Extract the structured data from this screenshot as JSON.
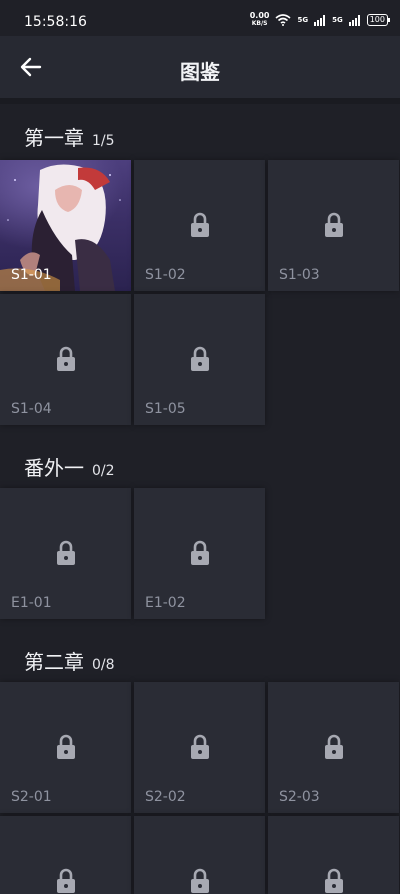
{
  "status": {
    "time": "15:58:16",
    "net_speed_value": "0.00",
    "net_speed_unit": "KB/S",
    "signal1": "5G",
    "signal2": "5G",
    "battery": "100"
  },
  "header": {
    "title": "图鉴"
  },
  "sections": [
    {
      "title": "第一章",
      "count": "1/5",
      "tiles": [
        {
          "label": "S1-01",
          "locked": false
        },
        {
          "label": "S1-02",
          "locked": true
        },
        {
          "label": "S1-03",
          "locked": true
        },
        {
          "label": "S1-04",
          "locked": true
        },
        {
          "label": "S1-05",
          "locked": true
        }
      ]
    },
    {
      "title": "番外一",
      "count": "0/2",
      "tiles": [
        {
          "label": "E1-01",
          "locked": true
        },
        {
          "label": "E1-02",
          "locked": true
        }
      ]
    },
    {
      "title": "第二章",
      "count": "0/8",
      "tiles": [
        {
          "label": "S2-01",
          "locked": true
        },
        {
          "label": "S2-02",
          "locked": true
        },
        {
          "label": "S2-03",
          "locked": true
        }
      ]
    }
  ]
}
